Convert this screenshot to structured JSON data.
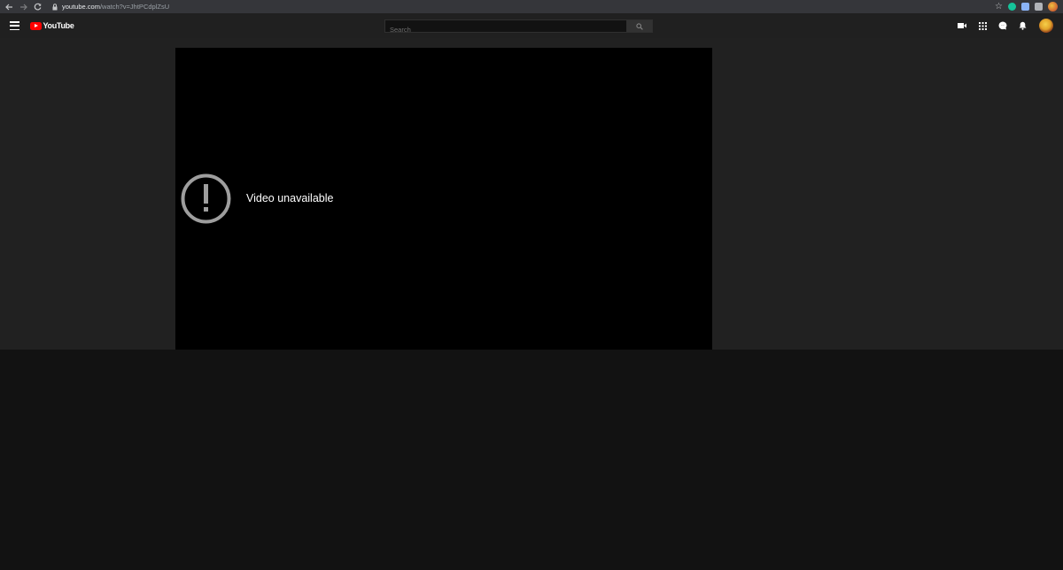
{
  "browser": {
    "url_host": "youtube.com",
    "url_path": "/watch?v=JhtPCdplZsU",
    "back_icon": "arrow-left-icon",
    "forward_icon": "arrow-right-icon",
    "reload_icon": "reload-icon",
    "bookmark_icon": "star-icon"
  },
  "masthead": {
    "logo_text": "YouTube",
    "search_placeholder": "Search",
    "icons": [
      "menu-icon",
      "youtube-logo-icon",
      "search-icon",
      "create-video-icon",
      "apps-grid-icon",
      "messages-icon",
      "notifications-bell-icon",
      "account-avatar"
    ]
  },
  "player": {
    "message": "Video unavailable",
    "icon": "exclamation-circle-icon"
  },
  "colors": {
    "chrome_bar": "#35363a",
    "masthead": "#202020",
    "page_background": "#212121",
    "lower_background": "#121212",
    "player_background": "#000000",
    "logo_red": "#ff0000"
  }
}
